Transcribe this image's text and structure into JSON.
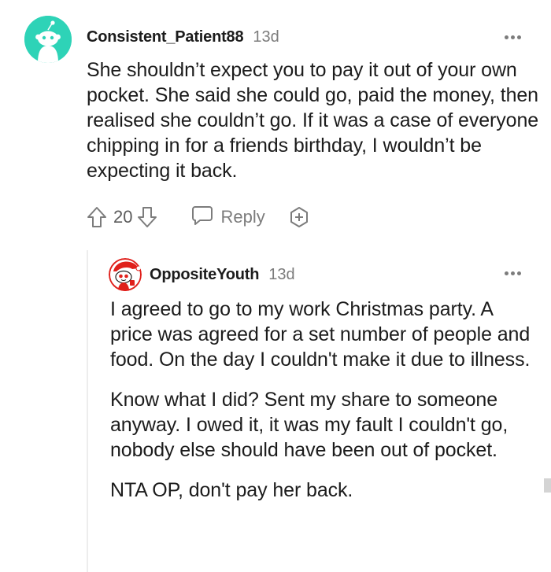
{
  "comments": [
    {
      "username": "Consistent_Patient88",
      "age": "13d",
      "paragraphs": [
        "She shouldn’t expect you to pay it out of your own pocket. She said she could go, paid the money, then realised she couldn’t go. If it was a case of everyone chipping in for a friends birthday, I wouldn’t be expecting it back."
      ],
      "score": "20",
      "reply_label": "Reply",
      "avatar_color": "#2ed3b7",
      "icons": [
        "upvote-icon",
        "downvote-icon",
        "reply-icon",
        "award-icon",
        "more-options-icon"
      ]
    },
    {
      "username": "OppositeYouth",
      "age": "13d",
      "paragraphs": [
        "I agreed to go to my work Christmas party. A price was agreed for a set number of people and food. On the day I couldn't make it due to illness.",
        "Know what I did? Sent my share to someone anyway. I owed it, it was my fault I couldn't go, nobody else should have been out of pocket.",
        "NTA OP, don't pay her back."
      ],
      "avatar_color": "#e0201b",
      "icons": [
        "more-options-icon"
      ]
    }
  ],
  "colors": {
    "text": "#1c1c1c",
    "meta": "#7c7c7c",
    "thread_line": "#ededed"
  }
}
